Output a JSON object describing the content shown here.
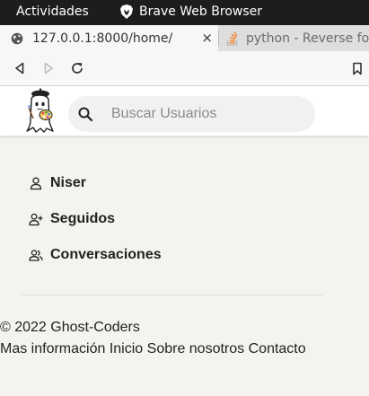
{
  "system_bar": {
    "activities": "Actividades",
    "app_name": "Brave Web Browser"
  },
  "tabs": [
    {
      "label": "127.0.0.1:8000/home/",
      "close": "×",
      "active": true,
      "favicon": "globe-icon"
    },
    {
      "label": "python - Reverse for",
      "active": false,
      "favicon": "stackoverflow-icon"
    }
  ],
  "navbar": {
    "icons": [
      "back-icon",
      "forward-icon",
      "reload-icon",
      "bookmark-icon"
    ]
  },
  "header": {
    "logo": "ghost-painter-logo",
    "search": {
      "placeholder": "Buscar Usuarios",
      "value": ""
    }
  },
  "menu": [
    {
      "label": "Niser",
      "icon": "user-icon"
    },
    {
      "label": "Seguidos",
      "icon": "user-plus-icon"
    },
    {
      "label": "Conversaciones",
      "icon": "users-icon"
    }
  ],
  "footer": {
    "copyright": "© 2022 Ghost-Coders",
    "links": [
      "Mas información",
      "Inicio",
      "Sobre nosotros",
      "Contacto"
    ]
  },
  "colors": {
    "page_background": "#f4f3ef",
    "header_background": "#ffffff",
    "system_bar": "#1d1d1d",
    "text": "#222222"
  }
}
